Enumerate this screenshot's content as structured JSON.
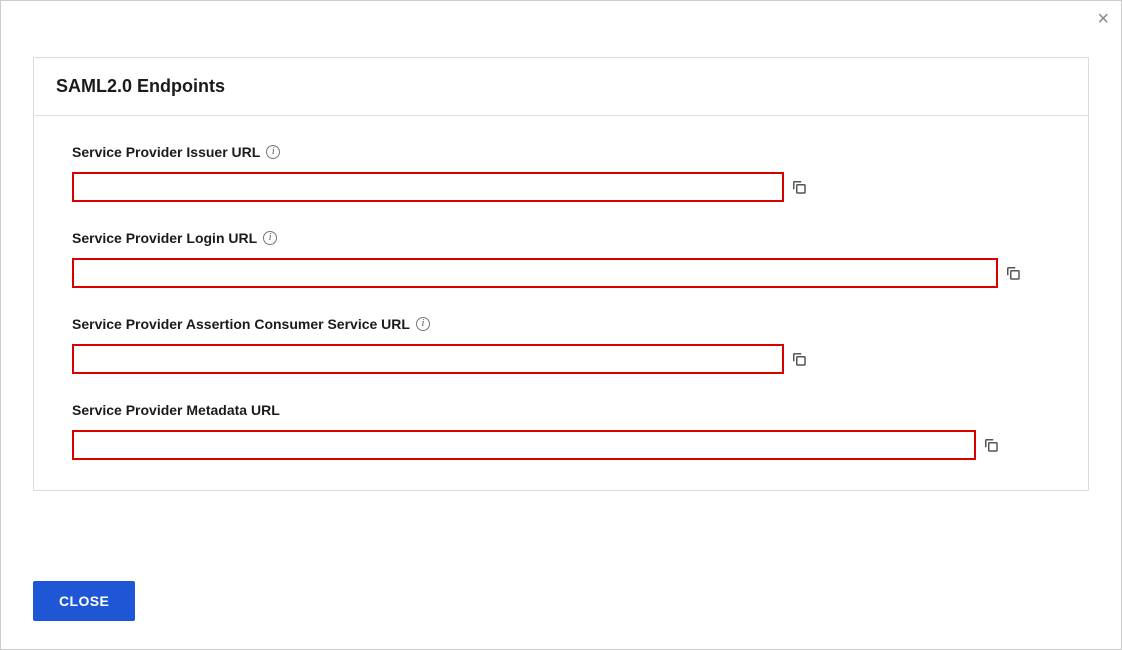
{
  "modal": {
    "title": "SAML2.0 Endpoints",
    "close_x": "×",
    "fields": {
      "issuer": {
        "label": "Service Provider Issuer URL",
        "value": "",
        "has_info": true
      },
      "login": {
        "label": "Service Provider Login URL",
        "value": "",
        "has_info": true
      },
      "acs": {
        "label": "Service Provider Assertion Consumer Service URL",
        "value": "",
        "has_info": true
      },
      "metadata": {
        "label": "Service Provider Metadata URL",
        "value": "",
        "has_info": false
      }
    },
    "close_button": "CLOSE"
  },
  "icons": {
    "info_glyph": "i"
  }
}
